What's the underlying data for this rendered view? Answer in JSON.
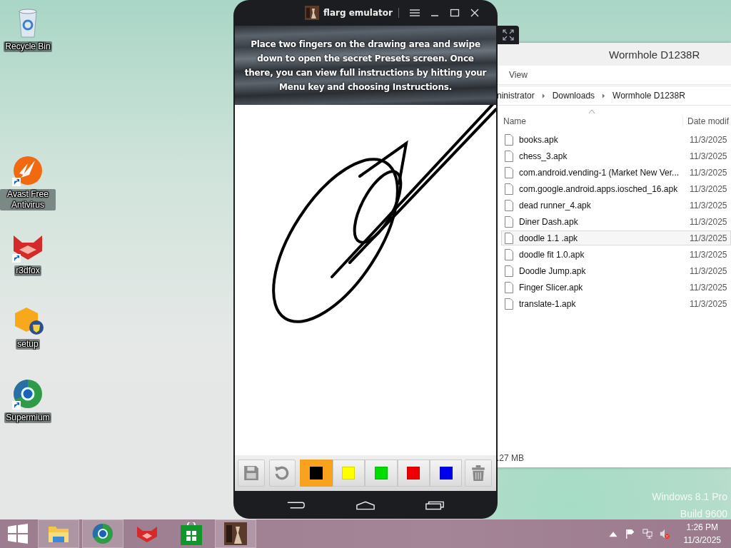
{
  "desktop_icons": [
    {
      "kind": "recycle-bin",
      "label": "Recycle Bin",
      "shortcut": false
    },
    {
      "kind": "avast",
      "label": "Avast Free Antivirus",
      "shortcut": true
    },
    {
      "kind": "r3dfox",
      "label": "r3dfox",
      "shortcut": true
    },
    {
      "kind": "setup",
      "label": "setup",
      "shortcut": false
    },
    {
      "kind": "supermium",
      "label": "Supermium",
      "shortcut": true
    }
  ],
  "emulator": {
    "title": "flarg emulator",
    "instructions": "Place two fingers on the drawing area and swipe down to open the secret Presets screen. Once there, you can view full instructions by hitting your Menu key and choosing Instructions.",
    "tools": [
      {
        "kind": "save"
      },
      {
        "kind": "undo"
      },
      {
        "kind": "color",
        "color": "#000000",
        "selected": true
      },
      {
        "kind": "color",
        "color": "#ffff00",
        "selected": false
      },
      {
        "kind": "color",
        "color": "#00dd00",
        "selected": false
      },
      {
        "kind": "color",
        "color": "#ee0000",
        "selected": false
      },
      {
        "kind": "color",
        "color": "#0000ee",
        "selected": false
      },
      {
        "kind": "trash"
      }
    ]
  },
  "explorer": {
    "title": "Wormhole D1238R",
    "menu": [
      "View"
    ],
    "breadcrumb": [
      "ninistrator",
      "Downloads",
      "Wormhole D1238R"
    ],
    "columns": [
      "Name",
      "Date modif"
    ],
    "files": [
      {
        "name": "books.apk",
        "date": "11/3/2025",
        "hovered": false
      },
      {
        "name": "chess_3.apk",
        "date": "11/3/2025",
        "hovered": false
      },
      {
        "name": "com.android.vending-1 (Market New Ver...",
        "date": "11/3/2025",
        "hovered": false
      },
      {
        "name": "com.google.android.apps.iosched_16.apk",
        "date": "11/3/2025",
        "hovered": false
      },
      {
        "name": "dead runner_4.apk",
        "date": "11/3/2025",
        "hovered": false
      },
      {
        "name": "Diner Dash.apk",
        "date": "11/3/2025",
        "hovered": false
      },
      {
        "name": "doodle 1.1 .apk",
        "date": "11/3/2025",
        "hovered": true
      },
      {
        "name": "doodle fit 1.0.apk",
        "date": "11/3/2025",
        "hovered": false
      },
      {
        "name": "Doodle Jump.apk",
        "date": "11/3/2025",
        "hovered": false
      },
      {
        "name": "Finger Slicer.apk",
        "date": "11/3/2025",
        "hovered": false
      },
      {
        "name": "translate-1.apk",
        "date": "11/3/2025",
        "hovered": false
      }
    ],
    "status": ".27 MB"
  },
  "os_edition": [
    "Windows 8.1 Pro",
    "Build 9600"
  ],
  "taskbar": {
    "apps": [
      {
        "kind": "explorer",
        "active": true
      },
      {
        "kind": "supermium",
        "active": true
      },
      {
        "kind": "r3dfox",
        "active": false
      },
      {
        "kind": "store",
        "active": false
      },
      {
        "kind": "emulator",
        "active": true
      }
    ],
    "time": "1:26 PM",
    "date": "11/3/2025"
  }
}
